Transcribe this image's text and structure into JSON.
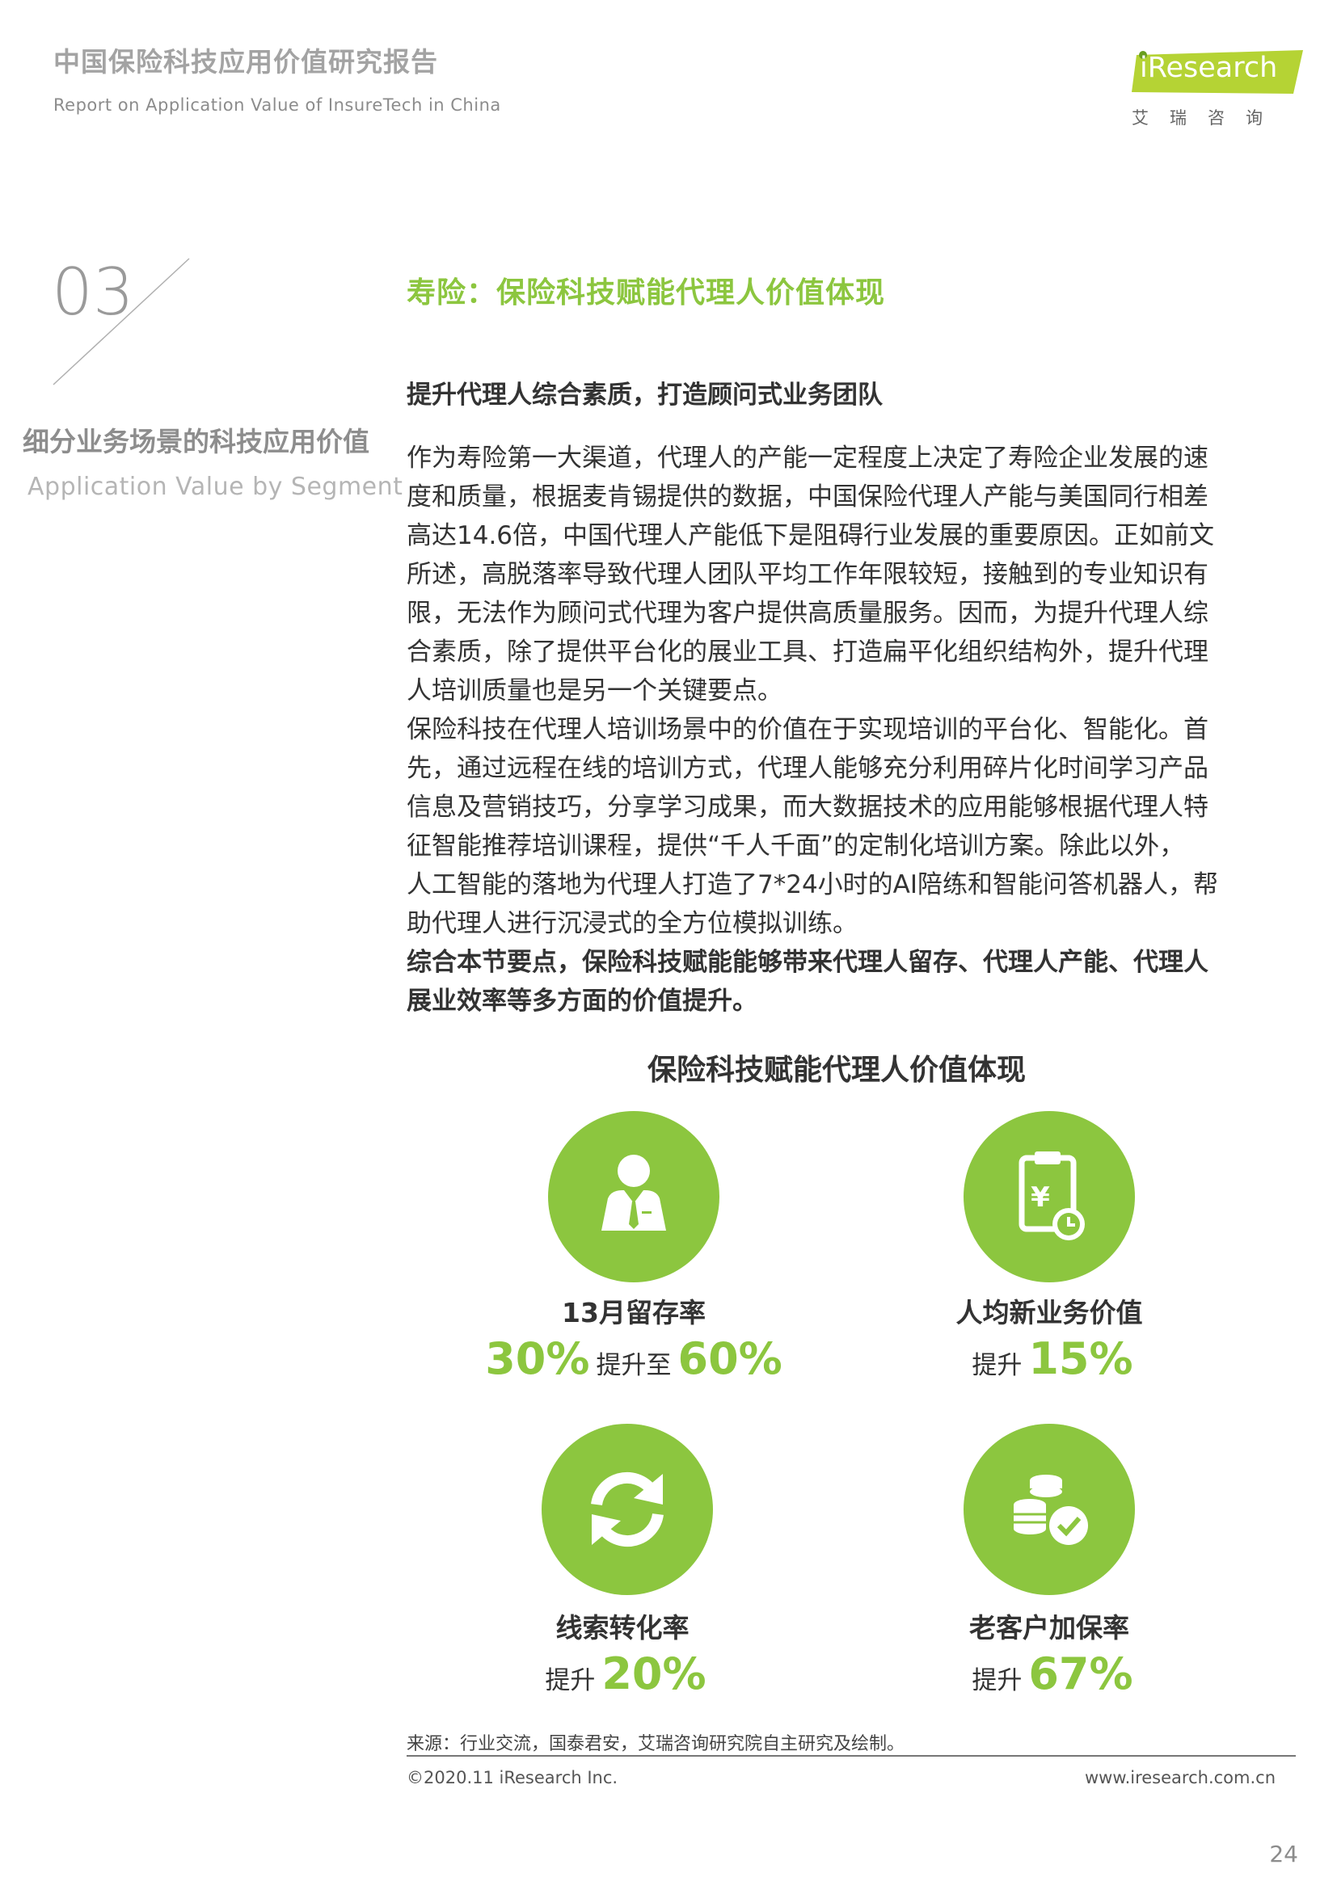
{
  "header": {
    "title": "中国保险科技应用价值研究报告",
    "subtitle": "Report on Application Value of InsureTech in China",
    "logo_word": "iResearch",
    "logo_cn": "艾瑞咨询"
  },
  "section": {
    "number": "03",
    "title": "细分业务场景的科技应用价值",
    "subtitle": "Application Value by Segment"
  },
  "main": {
    "heading": "寿险：保险科技赋能代理人价值体现",
    "subheading": "提升代理人综合素质，打造顾问式业务团队",
    "paragraph_lines": [
      "作为寿险第一大渠道，代理人的产能一定程度上决定了寿险企业发展的速",
      "度和质量，根据麦肯锡提供的数据，中国保险代理人产能与美国同行相差",
      "高达14.6倍，中国代理人产能低下是阻碍行业发展的重要原因。正如前文",
      "所述，高脱落率导致代理人团队平均工作年限较短，接触到的专业知识有",
      "限，无法作为顾问式代理为客户提供高质量服务。因而，为提升代理人综",
      "合素质，除了提供平台化的展业工具、打造扁平化组织结构外，提升代理",
      "人培训质量也是另一个关键要点。",
      "保险科技在代理人培训场景中的价值在于实现培训的平台化、智能化。首",
      "先，通过远程在线的培训方式，代理人能够充分利用碎片化时间学习产品",
      "信息及营销技巧，分享学习成果，而大数据技术的应用能够根据代理人特",
      "征智能推荐培训课程，提供“千人千面”的定制化培训方案。除此以外，",
      "人工智能的落地为代理人打造了7*24小时的AI陪练和智能问答机器人，帮",
      "助代理人进行沉浸式的全方位模拟训练。"
    ],
    "summary_lines": [
      "综合本节要点，保险科技赋能能够带来代理人留存、代理人产能、代理人",
      "展业效率等多方面的价值提升。"
    ]
  },
  "infographic": {
    "title": "保险科技赋能代理人价值体现",
    "metrics": [
      {
        "icon": "agent-icon",
        "label": "13月留存率",
        "from": "30%",
        "connector": "提升至",
        "to": "60%"
      },
      {
        "icon": "clipboard-yuan-icon",
        "label": "人均新业务价值",
        "prefix": "提升",
        "value": "15%"
      },
      {
        "icon": "refresh-icon",
        "label": "线索转化率",
        "prefix": "提升",
        "value": "20%"
      },
      {
        "icon": "coins-check-icon",
        "label": "老客户加保率",
        "prefix": "提升",
        "value": "67%"
      }
    ],
    "accent_color": "#8cc63f"
  },
  "footer": {
    "source": "来源：行业交流，国泰君安，艾瑞咨询研究院自主研究及绘制。",
    "copyright": "©2020.11 iResearch Inc.",
    "website": "www.iresearch.com.cn",
    "page_number": "24"
  }
}
